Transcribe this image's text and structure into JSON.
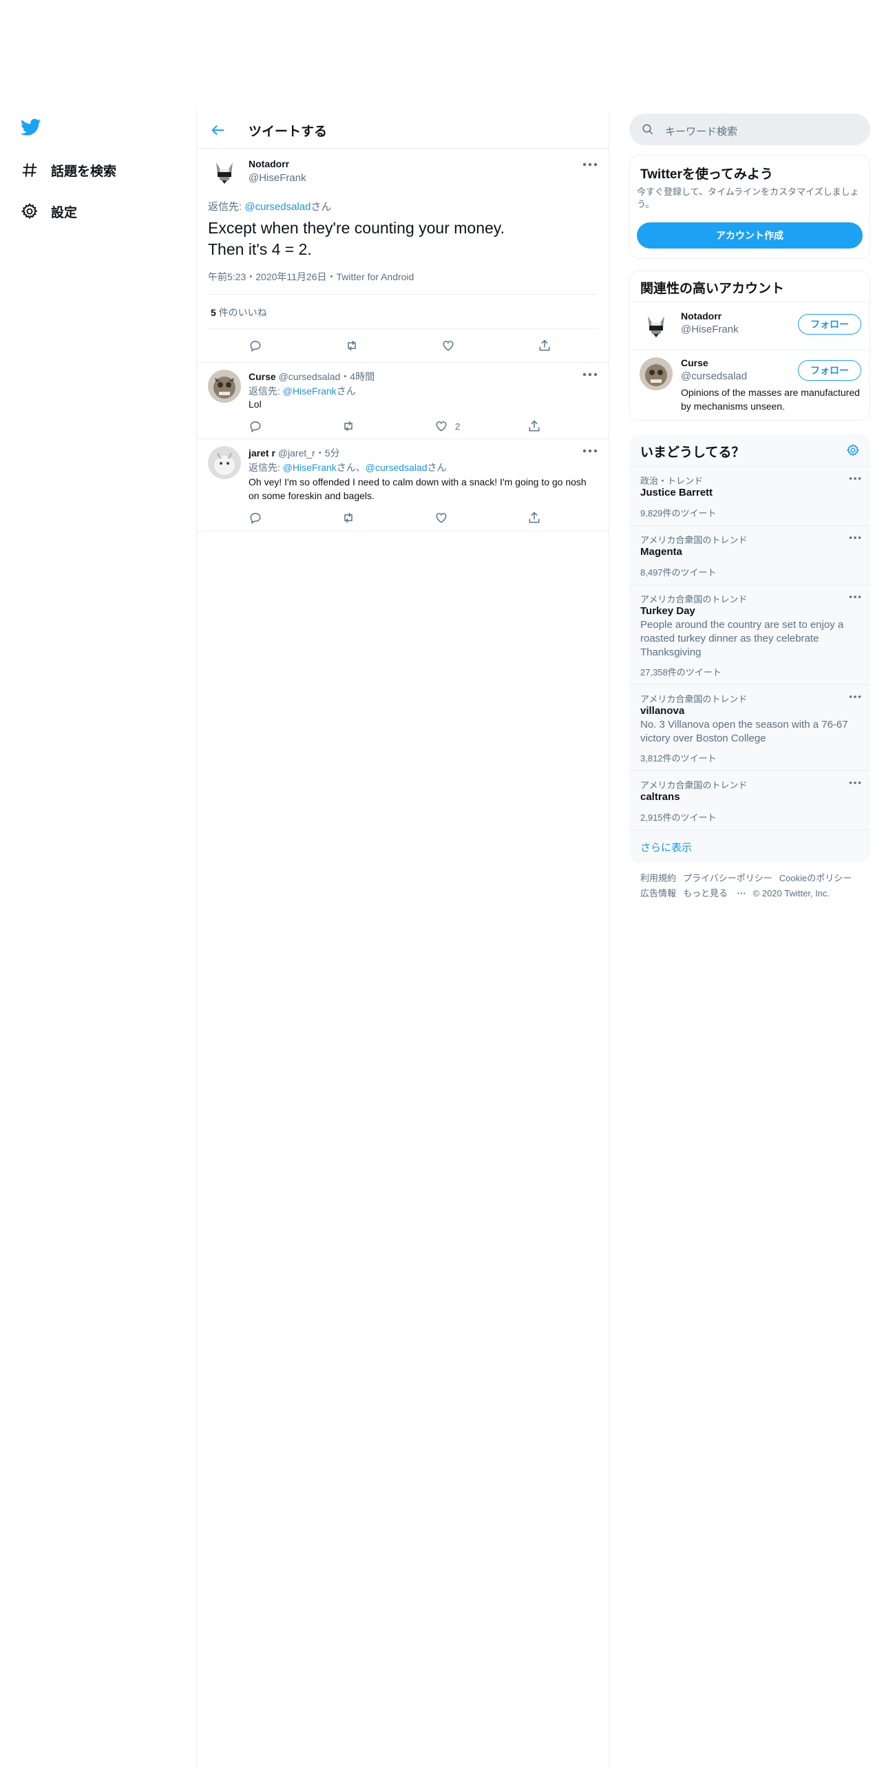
{
  "nav": {
    "logo": "twitter-bird-icon",
    "explore_label": "話題を検索",
    "settings_label": "設定"
  },
  "header": {
    "title": "ツイートする"
  },
  "main_tweet": {
    "name": "Notadorr",
    "handle": "@HiseFrank",
    "reply_prefix": "返信先: ",
    "reply_to": "@cursedsalad",
    "reply_suffix": "さん",
    "text_line1": "Except when they're counting your money.",
    "text_line2": "Then it's 4 = 2.",
    "meta": "午前5:23・2020年11月26日・Twitter for Android",
    "likes_count": "5",
    "likes_label": " 件のいいね"
  },
  "replies": [
    {
      "name": "Curse",
      "handle_time": "@cursedsalad・4時間",
      "reply_prefix": "返信先: ",
      "reply_to": "@HiseFrank",
      "reply_suffix": "さん",
      "text": "Lol",
      "like_count": "2"
    },
    {
      "name": "jaret r",
      "handle_time": "@jaret_r・5分",
      "reply_prefix": "返信先: ",
      "reply_to": "@HiseFrank",
      "reply_mid": "さん、",
      "reply_to2": "@cursedsalad",
      "reply_suffix": "さん",
      "text": "Oh vey! I'm so offended I need to calm down with a snack! I'm going to go nosh on some foreskin and bagels."
    }
  ],
  "search": {
    "placeholder": "キーワード検索"
  },
  "signup": {
    "title": "Twitterを使ってみよう",
    "subtitle": "今すぐ登録して、タイムラインをカスタマイズしましょう。",
    "button": "アカウント作成"
  },
  "related": {
    "title": "関連性の高いアカウント",
    "accounts": [
      {
        "name": "Notadorr",
        "handle": "@HiseFrank",
        "follow": "フォロー",
        "bio": ""
      },
      {
        "name": "Curse",
        "handle": "@cursedsalad",
        "follow": "フォロー",
        "bio": "Opinions of the masses are manufactured by mechanisms unseen."
      }
    ]
  },
  "trends": {
    "title": "いまどうしてる？",
    "items": [
      {
        "context": "政治・トレンド",
        "name": "Justice Barrett",
        "desc": "",
        "count": "9,829件のツイート"
      },
      {
        "context": "アメリカ合衆国のトレンド",
        "name": "Magenta",
        "desc": "",
        "count": "8,497件のツイート"
      },
      {
        "context": "アメリカ合衆国のトレンド",
        "name": "Turkey Day",
        "desc": "People around the country are set to enjoy a roasted turkey dinner as they celebrate Thanksgiving",
        "count": "27,358件のツイート"
      },
      {
        "context": "アメリカ合衆国のトレンド",
        "name": "villanova",
        "desc": "No. 3 Villanova open the season with a 76-67 victory over Boston College",
        "count": "3,812件のツイート"
      },
      {
        "context": "アメリカ合衆国のトレンド",
        "name": "caltrans",
        "desc": "",
        "count": "2,915件のツイート"
      }
    ],
    "show_more": "さらに表示"
  },
  "footer": {
    "terms": "利用規約",
    "privacy": "プライバシーポリシー",
    "cookies": "Cookieのポリシー",
    "ads": "広告情報",
    "more": "もっと見る",
    "copyright": "© 2020 Twitter, Inc."
  },
  "colors": {
    "accent": "#1da1f2",
    "link": "#1b95e0",
    "muted": "#5b7083",
    "border": "#ebeef0"
  }
}
